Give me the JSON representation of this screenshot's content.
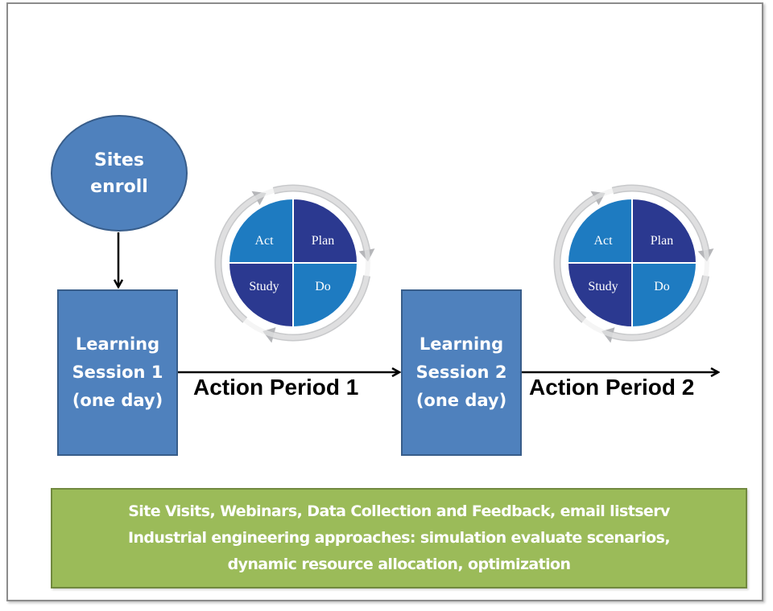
{
  "diagram": {
    "start_node": {
      "lines": [
        "Sites",
        "enroll"
      ]
    },
    "learning_sessions": [
      {
        "lines": [
          "Learning",
          "Session 1",
          "(one day)"
        ]
      },
      {
        "lines": [
          "Learning",
          "Session 2",
          "(one day)"
        ]
      }
    ],
    "action_periods": [
      {
        "label": "Action Period 1"
      },
      {
        "label": "Action Period 2"
      }
    ],
    "pdsa_cycles": [
      {
        "quadrants": {
          "top_left": "Act",
          "top_right": "Plan",
          "bottom_left": "Study",
          "bottom_right": "Do"
        }
      },
      {
        "quadrants": {
          "top_left": "Act",
          "top_right": "Plan",
          "bottom_left": "Study",
          "bottom_right": "Do"
        }
      }
    ],
    "support_box": {
      "lines": [
        "Site Visits, Webinars, Data Collection and Feedback, email  listserv",
        "Industrial engineering approaches: simulation evaluate scenarios,",
        "dynamic resource allocation, optimization"
      ]
    }
  },
  "colors": {
    "node_fill": "#4f81bd",
    "node_border": "#385d8a",
    "pdsa_light": "#1e7bc1",
    "pdsa_dark": "#2b3990",
    "support_fill": "#9bbb59",
    "support_border": "#71893f",
    "cycle_arrow": "#c8c9cb"
  }
}
